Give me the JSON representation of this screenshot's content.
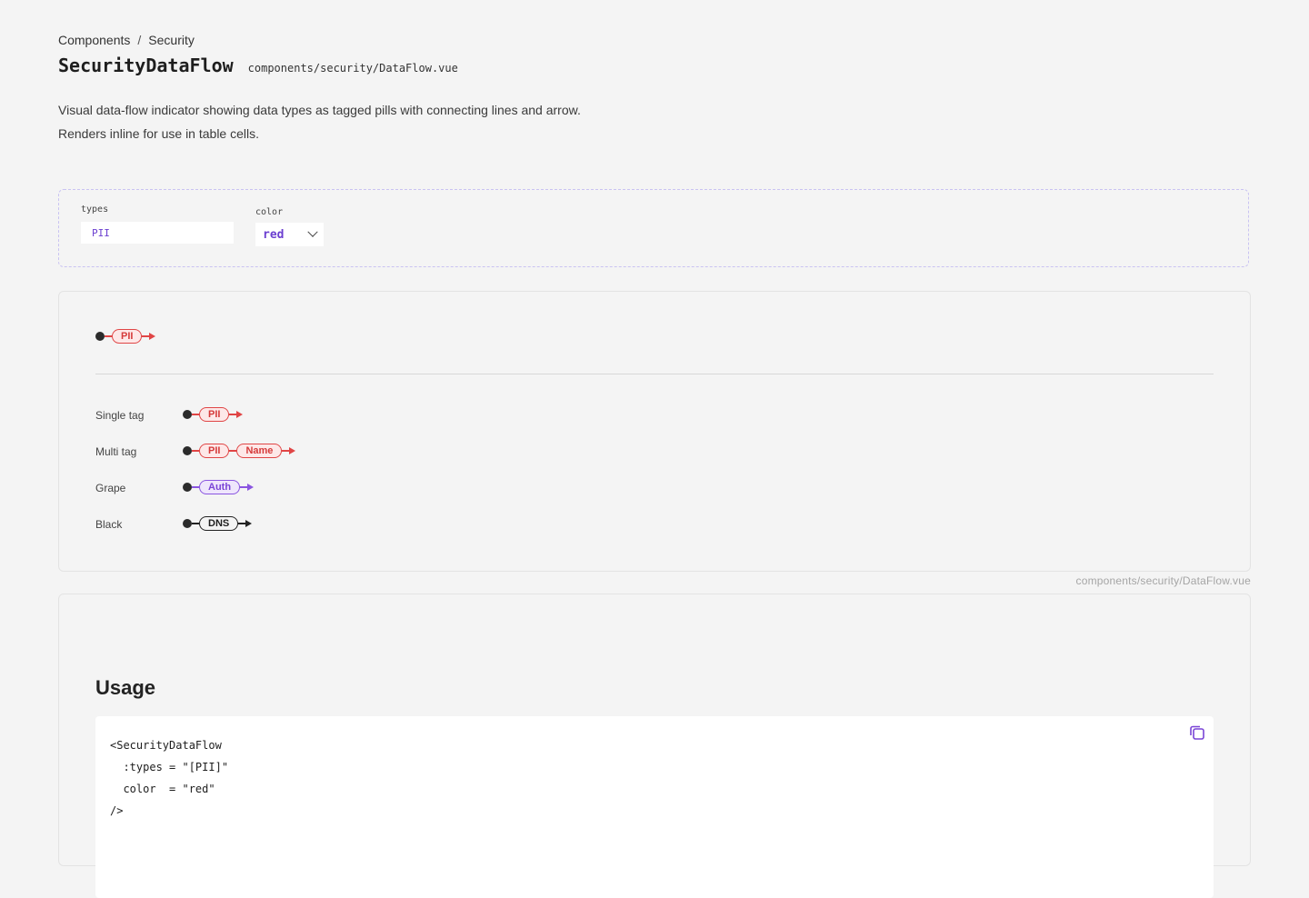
{
  "breadcrumb": {
    "items": [
      "Components",
      "Security"
    ],
    "separator": "/"
  },
  "header": {
    "title": "SecurityDataFlow",
    "path": "components/security/DataFlow.vue"
  },
  "description": "Visual data-flow indicator showing data types as tagged pills with connecting lines and arrow. Renders inline for use in table cells.",
  "controls": {
    "types": {
      "label": "types",
      "value": "PII"
    },
    "color": {
      "label": "color",
      "value": "red",
      "options": [
        "red"
      ]
    }
  },
  "demo": {
    "main": {
      "tags": [
        "PII"
      ],
      "color": "red"
    },
    "variants": [
      {
        "label": "Single tag",
        "tags": [
          "PII"
        ],
        "color": "red"
      },
      {
        "label": "Multi tag",
        "tags": [
          "PII",
          "Name"
        ],
        "color": "red"
      },
      {
        "label": "Grape",
        "tags": [
          "Auth"
        ],
        "color": "grape"
      },
      {
        "label": "Black",
        "tags": [
          "DNS"
        ],
        "color": "black"
      }
    ]
  },
  "source_link": "components/security/DataFlow.vue",
  "usage": {
    "heading": "Usage",
    "code": "<SecurityDataFlow\n  :types = \"[PII]\"\n  color  = \"red\"\n/>",
    "copy_icon": "copy-icon"
  },
  "colors": {
    "red": "#e04545",
    "grape": "#8a55e0",
    "black": "#222222",
    "accent": "#6b3fd0"
  }
}
